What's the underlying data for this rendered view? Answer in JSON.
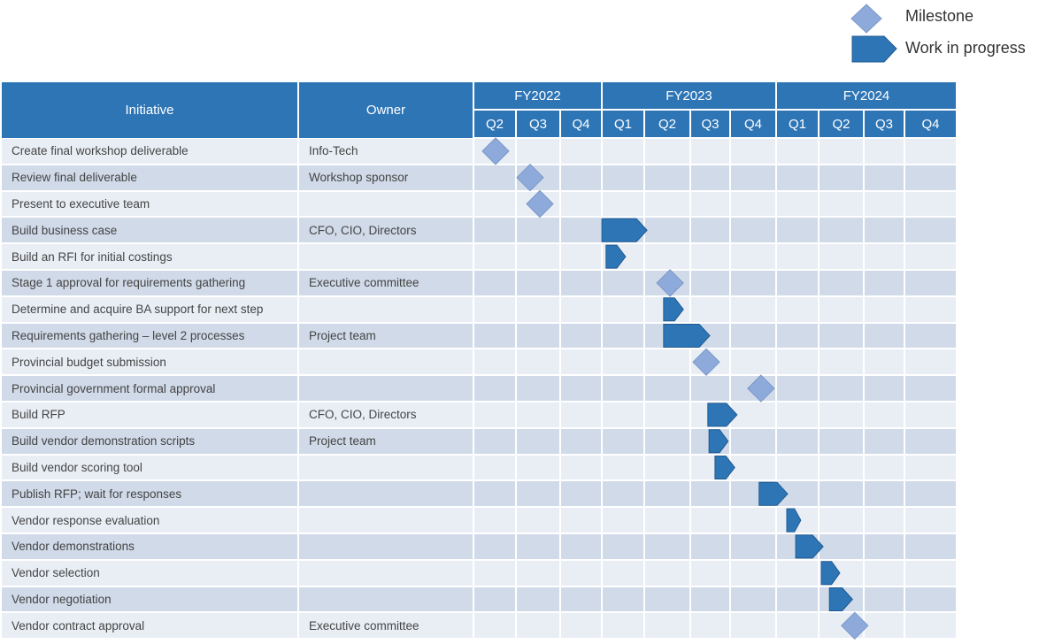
{
  "legend": {
    "milestone_label": "Milestone",
    "wip_label": "Work in progress"
  },
  "colors": {
    "header": "#2e75b6",
    "row_light": "#e9eef5",
    "row_dark": "#d0dae8",
    "milestone": "#8eaadb",
    "wip": "#2e75b6"
  },
  "table": {
    "initiative_header": "Initiative",
    "owner_header": "Owner"
  },
  "chart_data": {
    "type": "gantt",
    "years": [
      {
        "label": "FY2022",
        "quarters": [
          "Q2",
          "Q3",
          "Q4"
        ]
      },
      {
        "label": "FY2023",
        "quarters": [
          "Q1",
          "Q2",
          "Q3",
          "Q4"
        ]
      },
      {
        "label": "FY2024",
        "quarters": [
          "Q1",
          "Q2",
          "Q3",
          "Q4"
        ]
      }
    ],
    "time_unit": "quarters from start of FY2022 Q2",
    "tasks": [
      {
        "initiative": "Create final workshop deliverable",
        "owner": "Info-Tech",
        "type": "milestone",
        "at": 0.52
      },
      {
        "initiative": "Review final deliverable",
        "owner": "Workshop sponsor",
        "type": "milestone",
        "at": 1.32
      },
      {
        "initiative": "Present to executive team",
        "owner": "",
        "type": "milestone",
        "at": 1.54
      },
      {
        "initiative": "Build business case",
        "owner": "CFO, CIO, Directors",
        "type": "wip",
        "start": 3.0,
        "end": 4.06
      },
      {
        "initiative": "Build an RFI for initial costings",
        "owner": "",
        "type": "wip",
        "start": 3.1,
        "end": 3.56
      },
      {
        "initiative": "Stage 1 approval for requirements gathering",
        "owner": "Executive committee",
        "type": "milestone",
        "at": 4.56
      },
      {
        "initiative": "Determine and acquire BA support for next step",
        "owner": "",
        "type": "wip",
        "start": 4.42,
        "end": 4.85
      },
      {
        "initiative": "Requirements gathering – level 2 processes",
        "owner": "Project team",
        "type": "wip",
        "start": 4.42,
        "end": 5.49
      },
      {
        "initiative": "Provincial budget submission",
        "owner": "",
        "type": "milestone",
        "at": 5.4
      },
      {
        "initiative": "Provincial government formal approval",
        "owner": "",
        "type": "milestone",
        "at": 6.67
      },
      {
        "initiative": "Build RFP",
        "owner": "CFO, CIO, Directors",
        "type": "wip",
        "start": 5.44,
        "end": 6.15
      },
      {
        "initiative": "Build vendor demonstration scripts",
        "owner": "Project team",
        "type": "wip",
        "start": 5.47,
        "end": 5.95
      },
      {
        "initiative": "Build vendor scoring tool",
        "owner": "",
        "type": "wip",
        "start": 5.62,
        "end": 6.1
      },
      {
        "initiative": "Publish RFP; wait for responses",
        "owner": "",
        "type": "wip",
        "start": 6.63,
        "end": 7.27
      },
      {
        "initiative": "Vendor response evaluation",
        "owner": "",
        "type": "wip",
        "start": 7.25,
        "end": 7.58
      },
      {
        "initiative": "Vendor demonstrations",
        "owner": "",
        "type": "wip",
        "start": 7.46,
        "end": 8.1
      },
      {
        "initiative": "Vendor selection",
        "owner": "",
        "type": "wip",
        "start": 8.06,
        "end": 8.47
      },
      {
        "initiative": "Vendor negotiation",
        "owner": "",
        "type": "wip",
        "start": 8.24,
        "end": 8.75
      },
      {
        "initiative": "Vendor contract approval",
        "owner": "Executive committee",
        "type": "milestone",
        "at": 8.8
      }
    ]
  }
}
